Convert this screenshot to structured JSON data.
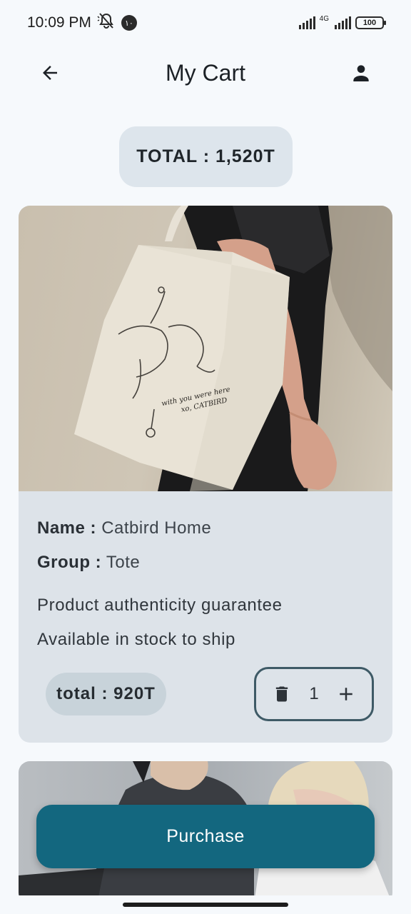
{
  "status_bar": {
    "time": "10:09 PM",
    "notification_badge": "١٠",
    "network_label": "4G",
    "battery": "100"
  },
  "header": {
    "title": "My Cart",
    "back_icon": "arrow-left-icon",
    "profile_icon": "person-icon"
  },
  "cart_total": "TOTAL : 1,520T",
  "items": [
    {
      "name_label": "Name :",
      "name_value": "Catbird Home",
      "group_label": "Group :",
      "group_value": "Tote",
      "desc_1": "Product authenticity guarantee",
      "desc_2": "Available in stock to ship",
      "subtotal": "total : 920T",
      "quantity": "1",
      "bag_print_text": "with you were here xo, CATBIRD"
    }
  ],
  "purchase_label": "Purchase",
  "colors": {
    "accent": "#13677f",
    "card_bg": "#dde3e9",
    "pill_bg": "#dde5ec",
    "stepper_border": "#3e5a66"
  }
}
